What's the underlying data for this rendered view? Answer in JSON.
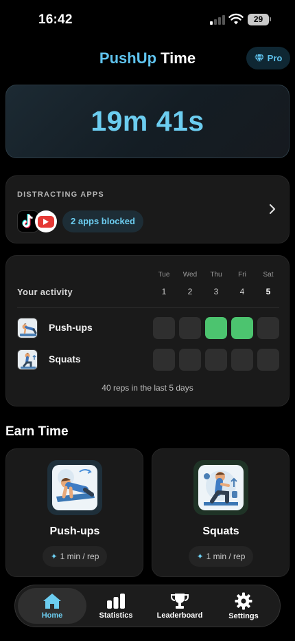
{
  "status_bar": {
    "time": "16:42",
    "battery": "29"
  },
  "header": {
    "title_accent": "PushUp",
    "title_rest": " Time",
    "pro_label": "Pro"
  },
  "timer": {
    "value": "19m 41s"
  },
  "distracting_apps": {
    "label": "DISTRACTING APPS",
    "apps": [
      "tiktok-icon",
      "youtube-icon"
    ],
    "blocked_text": "2 apps blocked"
  },
  "activity": {
    "title": "Your activity",
    "days": [
      {
        "name": "Tue",
        "num": "1"
      },
      {
        "name": "Wed",
        "num": "2"
      },
      {
        "name": "Thu",
        "num": "3"
      },
      {
        "name": "Fri",
        "num": "4"
      },
      {
        "name": "Sat",
        "num": "5"
      }
    ],
    "exercises": [
      {
        "name": "Push-ups",
        "completed": [
          false,
          false,
          true,
          true,
          false
        ]
      },
      {
        "name": "Squats",
        "completed": [
          false,
          false,
          false,
          false,
          false
        ]
      }
    ],
    "summary": "40 reps in the last 5 days"
  },
  "earn": {
    "title": "Earn Time",
    "cards": [
      {
        "name": "Push-ups",
        "rate": "1 min / rep"
      },
      {
        "name": "Squats",
        "rate": "1 min / rep"
      }
    ]
  },
  "tabs": [
    {
      "label": "Home",
      "icon": "house-icon",
      "active": true
    },
    {
      "label": "Statistics",
      "icon": "bar-chart-icon",
      "active": false
    },
    {
      "label": "Leaderboard",
      "icon": "trophy-icon",
      "active": false
    },
    {
      "label": "Settings",
      "icon": "gear-icon",
      "active": false
    }
  ],
  "colors": {
    "accent": "#5fc3ee",
    "success": "#4cc46f",
    "background": "#000000",
    "card": "#1a1a1a"
  }
}
